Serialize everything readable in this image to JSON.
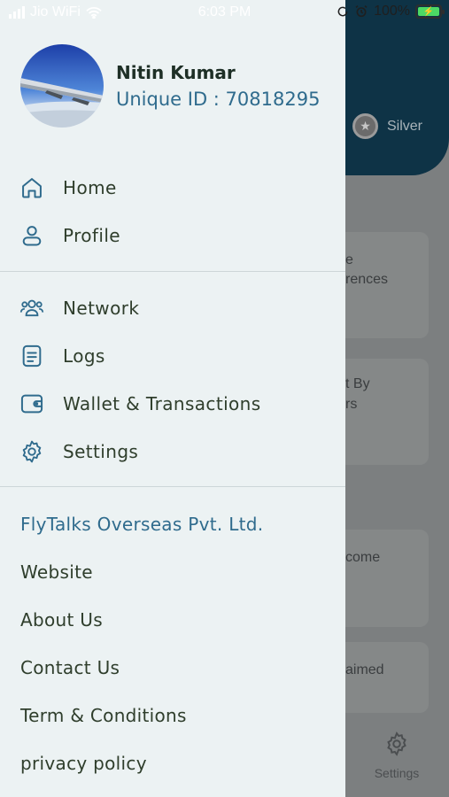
{
  "status_bar": {
    "carrier": "Jio WiFi",
    "time": "6:03 PM",
    "battery": "100%"
  },
  "background": {
    "badge_label": "Silver",
    "card_snippets": [
      "e",
      "rences",
      "t By",
      "rs",
      "come",
      "aimed"
    ],
    "tab_settings_label": "Settings"
  },
  "profile": {
    "name": "Nitin Kumar",
    "unique_id": "Unique ID : 70818295"
  },
  "menu": {
    "primary": [
      {
        "label": "Home",
        "icon": "home-icon"
      },
      {
        "label": "Profile",
        "icon": "user-icon"
      }
    ],
    "secondary": [
      {
        "label": "Network",
        "icon": "people-icon"
      },
      {
        "label": "Logs",
        "icon": "document-icon"
      },
      {
        "label": "Wallet & Transactions",
        "icon": "wallet-icon"
      },
      {
        "label": "Settings",
        "icon": "gear-icon"
      }
    ],
    "links": [
      "FlyTalks Overseas Pvt. Ltd.",
      "Website",
      "About Us",
      "Contact Us",
      "Term & Conditions",
      "privacy policy"
    ]
  },
  "colors": {
    "accent": "#2f6b8d",
    "drawer_bg": "#ecf2f3",
    "text": "#2f3e2c",
    "header_bg": "#0e3346"
  }
}
